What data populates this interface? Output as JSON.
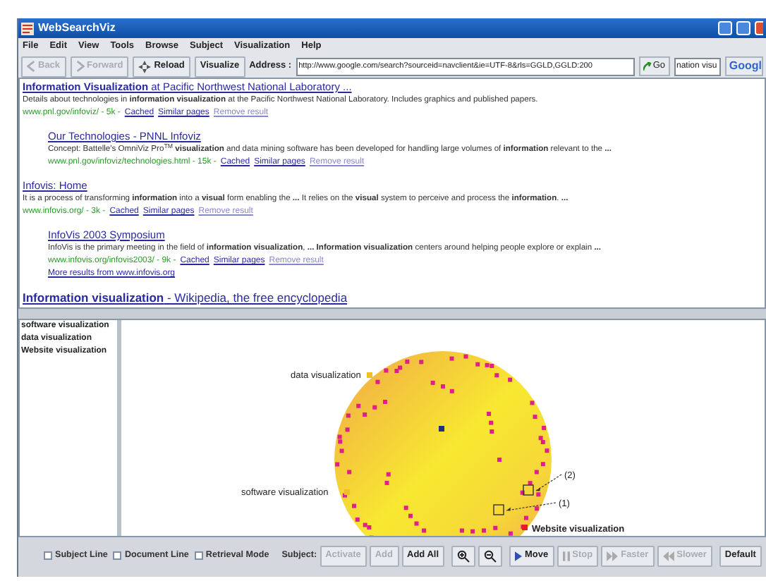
{
  "window": {
    "title": "WebSearchViz"
  },
  "menu": [
    "File",
    "Edit",
    "View",
    "Tools",
    "Browse",
    "Subject",
    "Visualization",
    "Help"
  ],
  "toolbar": {
    "buttons": [
      {
        "label": "Back",
        "kind": "back",
        "disabled": true
      },
      {
        "label": "Forward",
        "kind": "forward",
        "disabled": true
      },
      {
        "label": "Reload",
        "kind": "reload",
        "disabled": false
      },
      {
        "label": "Visualize",
        "kind": "text",
        "disabled": false
      }
    ],
    "address_label": "Address :",
    "address": "http://www.google.com/search?sourceid=navclient&ie=UTF-8&rls=GGLD,GGLD:200",
    "go": "Go",
    "search": "nation visu",
    "search_button": "Googl"
  },
  "results": [
    {
      "title": "**Information Visualization** at Pacific Northwest National Laboratory ...",
      "snippet": "Details about technologies in **information visualization** at the Pacific Northwest National Laboratory. Includes graphics and published papers.",
      "url": "www.pnl.gov/infoviz/ - 5k -",
      "cached": "Cached",
      "similar": "Similar pages",
      "remove": "Remove result",
      "children": [
        {
          "title": "Our Technologies - PNNL Infoviz",
          "snippet": "Concept: Battelle's OmniViz Pro$^{TM}$ **visualization** and data mining software has been developed for handling large volumes of **information** relevant to the **...**",
          "url": "www.pnl.gov/infoviz/technologies.html - 15k -",
          "cached": "Cached",
          "similar": "Similar pages",
          "remove": "Remove result"
        }
      ]
    },
    {
      "title": "Infovis: Home",
      "snippet": "It is a process of transforming **information** into a **visual** form enabling the **...** It relies on the **visual** system to perceive and process the **information**. **...**",
      "url": "www.infovis.org/ - 3k -",
      "cached": "Cached",
      "similar": "Similar pages",
      "remove": "Remove result",
      "children": [
        {
          "title": "InfoVis 2003 Symposium",
          "snippet": "InfoVis is the primary meeting in the field of **information visualization**, **... Information visualization** centers around helping people explore or explain **...**",
          "url": "www.infovis.org/infovis2003/ - 9k -",
          "cached": "Cached",
          "similar": "Similar pages",
          "remove": "Remove result",
          "more": "More results from www.infovis.org"
        }
      ]
    },
    {
      "title": "**Information visualization** - Wikipedia, the free encyclopedia"
    }
  ],
  "subjects": [
    {
      "label": "software visualization"
    },
    {
      "label": "data visualization"
    },
    {
      "label": "Website visualization"
    }
  ],
  "canvas": {
    "labels": [
      {
        "text": "data visualization",
        "kind": "subject",
        "color": "#f0c020"
      },
      {
        "text": "(2)",
        "kind": "callout"
      },
      {
        "text": "software visualization",
        "kind": "subject",
        "color": "#f0c020"
      },
      {
        "text": "(1)",
        "kind": "callout"
      },
      {
        "text": "Website visualization",
        "kind": "subject",
        "color": "#e02020"
      }
    ]
  },
  "controls": {
    "checkboxes": [
      {
        "label": "Subject Line",
        "checked": false
      },
      {
        "label": "Document Line",
        "checked": false
      },
      {
        "label": "Retrieval Mode",
        "checked": false
      }
    ],
    "subject_label": "Subject:",
    "buttons": [
      {
        "label": "Activate",
        "kind": "text",
        "disabled": true
      },
      {
        "label": "Add",
        "kind": "text",
        "disabled": true
      },
      {
        "label": "Add All",
        "kind": "text",
        "disabled": false
      },
      {
        "kind": "zoom-in",
        "disabled": false
      },
      {
        "kind": "zoom-out",
        "disabled": false
      },
      {
        "label": "Move",
        "kind": "play",
        "disabled": false
      },
      {
        "label": "Stop",
        "kind": "pause",
        "disabled": true
      },
      {
        "label": "Faster",
        "kind": "fast",
        "disabled": true
      },
      {
        "label": "Slower",
        "kind": "rewind",
        "disabled": true
      },
      {
        "label": "Default",
        "kind": "text",
        "disabled": false
      }
    ]
  }
}
